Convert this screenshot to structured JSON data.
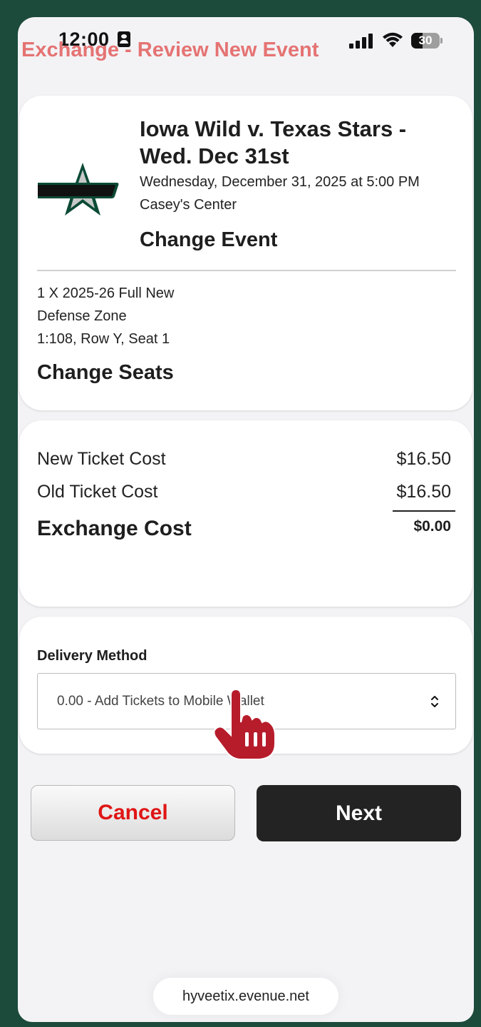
{
  "status_bar": {
    "time": "12:00",
    "battery": "30"
  },
  "page": {
    "title": "Exchange - Review New Event"
  },
  "event": {
    "title": "Iowa Wild v. Texas Stars - Wed. Dec 31st",
    "date": "Wednesday, December 31, 2025 at 5:00 PM",
    "venue": "Casey's Center",
    "change_event_label": "Change Event",
    "logo_icon": "texas-stars-logo-icon"
  },
  "seats": {
    "lines": [
      "1 X 2025-26 Full New",
      "Defense Zone",
      "1:108, Row Y, Seat 1"
    ],
    "change_seats_label": "Change Seats"
  },
  "costs": {
    "new_label": "New Ticket Cost",
    "new_value": "$16.50",
    "old_label": "Old Ticket Cost",
    "old_value": "$16.50",
    "exchange_label": "Exchange Cost",
    "exchange_value": "$0.00"
  },
  "delivery": {
    "label": "Delivery Method",
    "selected": "0.00 - Add Tickets to Mobile Wallet"
  },
  "actions": {
    "cancel_label": "Cancel",
    "next_label": "Next"
  },
  "browser": {
    "url": "hyveetix.evenue.net"
  },
  "colors": {
    "frame": "#1c4a3b",
    "title": "#e57373",
    "cancel_text": "#e01515",
    "next_bg": "#232323",
    "cursor": "#b71c2b"
  }
}
